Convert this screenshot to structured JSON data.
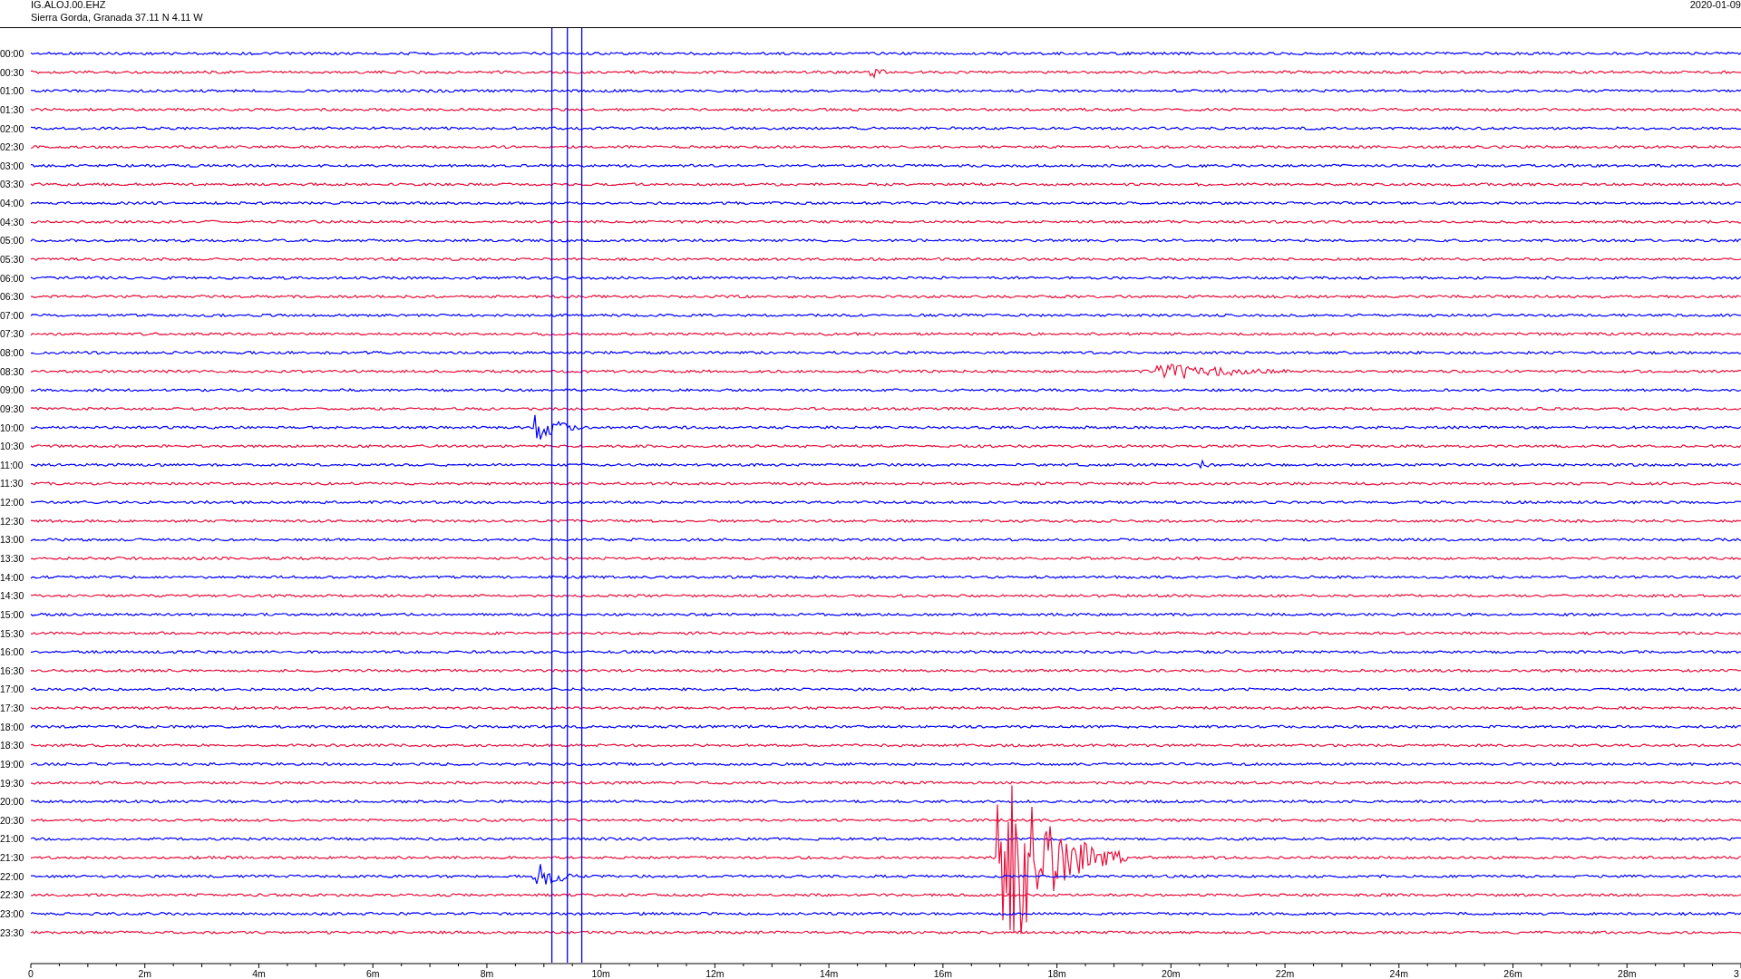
{
  "header": {
    "station": "IG.ALOJ.00.EHZ",
    "location": "Sierra Gorda, Granada  37.11 N 4.11 W",
    "date": "2020-01-09"
  },
  "traces": [
    {
      "label": "00:00",
      "color": "#0000ff"
    },
    {
      "label": "00:30",
      "color": "#e8103c"
    },
    {
      "label": "01:00",
      "color": "#0000ff"
    },
    {
      "label": "01:30",
      "color": "#e8103c"
    },
    {
      "label": "02:00",
      "color": "#0000ff"
    },
    {
      "label": "02:30",
      "color": "#e8103c"
    },
    {
      "label": "03:00",
      "color": "#0000ff"
    },
    {
      "label": "03:30",
      "color": "#e8103c"
    },
    {
      "label": "04:00",
      "color": "#0000ff"
    },
    {
      "label": "04:30",
      "color": "#e8103c"
    },
    {
      "label": "05:00",
      "color": "#0000ff"
    },
    {
      "label": "05:30",
      "color": "#e8103c"
    },
    {
      "label": "06:00",
      "color": "#0000ff"
    },
    {
      "label": "06:30",
      "color": "#e8103c"
    },
    {
      "label": "07:00",
      "color": "#0000ff"
    },
    {
      "label": "07:30",
      "color": "#e8103c"
    },
    {
      "label": "08:00",
      "color": "#0000ff"
    },
    {
      "label": "08:30",
      "color": "#e8103c"
    },
    {
      "label": "09:00",
      "color": "#0000ff"
    },
    {
      "label": "09:30",
      "color": "#e8103c"
    },
    {
      "label": "10:00",
      "color": "#0000ff"
    },
    {
      "label": "10:30",
      "color": "#e8103c"
    },
    {
      "label": "11:00",
      "color": "#0000ff"
    },
    {
      "label": "11:30",
      "color": "#e8103c"
    },
    {
      "label": "12:00",
      "color": "#0000ff"
    },
    {
      "label": "12:30",
      "color": "#e8103c"
    },
    {
      "label": "13:00",
      "color": "#0000ff"
    },
    {
      "label": "13:30",
      "color": "#e8103c"
    },
    {
      "label": "14:00",
      "color": "#0000ff"
    },
    {
      "label": "14:30",
      "color": "#e8103c"
    },
    {
      "label": "15:00",
      "color": "#0000ff"
    },
    {
      "label": "15:30",
      "color": "#e8103c"
    },
    {
      "label": "16:00",
      "color": "#0000ff"
    },
    {
      "label": "16:30",
      "color": "#e8103c"
    },
    {
      "label": "17:00",
      "color": "#0000ff"
    },
    {
      "label": "17:30",
      "color": "#e8103c"
    },
    {
      "label": "18:00",
      "color": "#0000ff"
    },
    {
      "label": "18:30",
      "color": "#e8103c"
    },
    {
      "label": "19:00",
      "color": "#0000ff"
    },
    {
      "label": "19:30",
      "color": "#e8103c"
    },
    {
      "label": "20:00",
      "color": "#0000ff"
    },
    {
      "label": "20:30",
      "color": "#e8103c"
    },
    {
      "label": "21:00",
      "color": "#0000ff"
    },
    {
      "label": "21:30",
      "color": "#e8103c"
    },
    {
      "label": "22:00",
      "color": "#0000ff"
    },
    {
      "label": "22:30",
      "color": "#e8103c"
    },
    {
      "label": "23:00",
      "color": "#0000ff"
    },
    {
      "label": "23:30",
      "color": "#e8103c"
    }
  ],
  "axis": {
    "ticks": [
      "0",
      "2m",
      "4m",
      "6m",
      "8m",
      "10m",
      "12m",
      "14m",
      "16m",
      "18m",
      "20m",
      "22m",
      "24m",
      "26m",
      "28m",
      "3"
    ]
  }
}
